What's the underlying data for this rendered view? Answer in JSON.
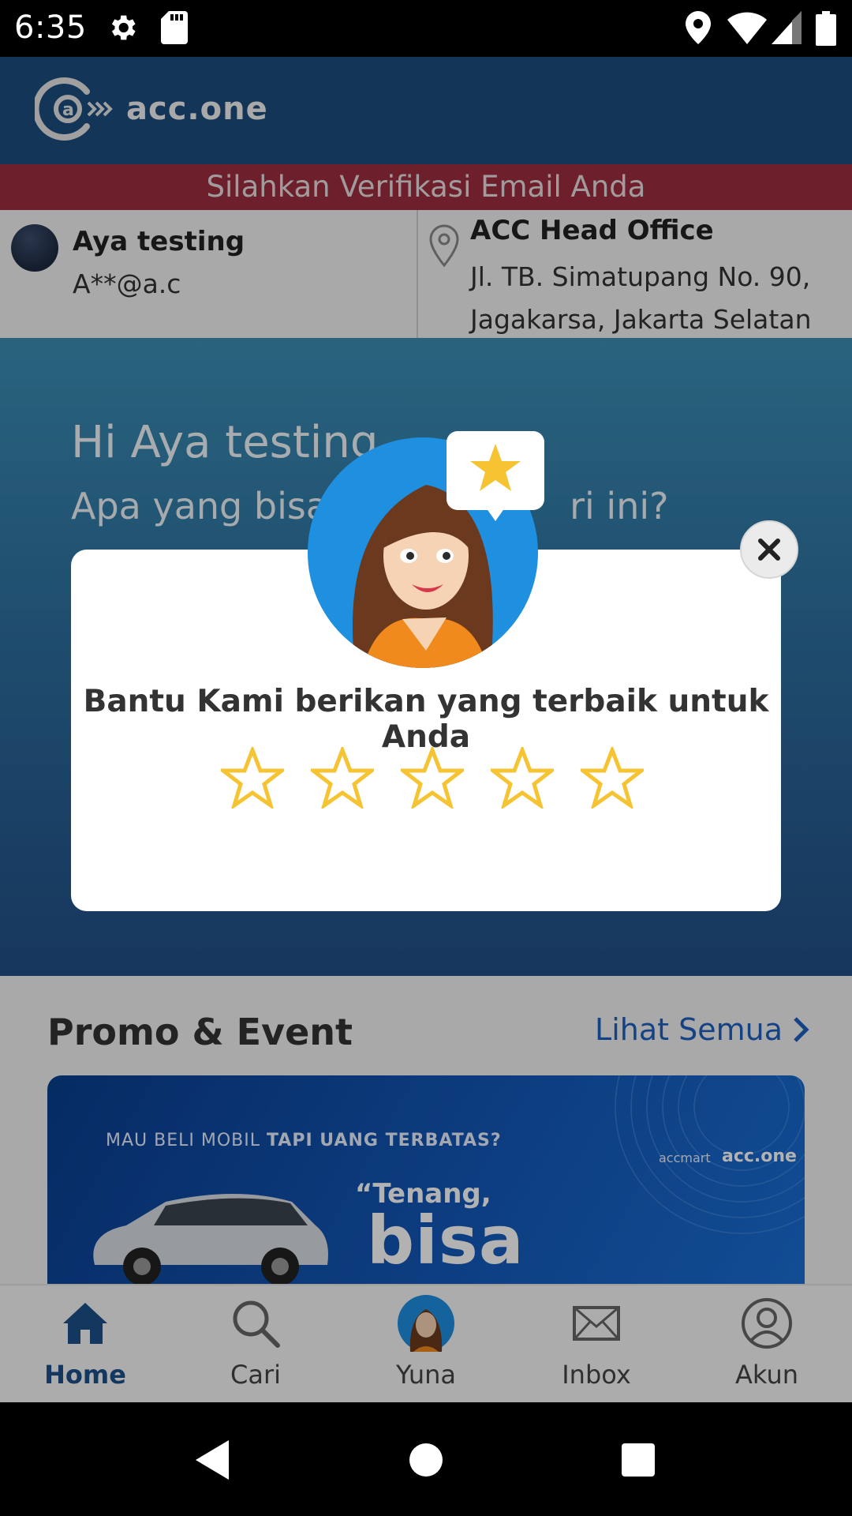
{
  "status_bar": {
    "time": "6:35"
  },
  "header": {
    "logo_text": "acc.one"
  },
  "verify_banner": {
    "text": "Silahkan Verifikasi Email Anda"
  },
  "user": {
    "name": "Aya testing",
    "email": "A**@a.c"
  },
  "office": {
    "name": "ACC Head Office",
    "address_line1": "Jl. TB. Simatupang No. 90,",
    "address_line2": "Jagakarsa, Jakarta Selatan"
  },
  "hero": {
    "greeting": "Hi Aya testing",
    "question": "Apa yang bisa A",
    "question_end": "ri ini?"
  },
  "dialog": {
    "message": "Bantu Kami berikan yang terbaik untuk Anda",
    "rating": 0,
    "max_rating": 5
  },
  "promo": {
    "title": "Promo & Event",
    "see_all": "Lihat Semua",
    "banner": {
      "line1_a": "MAU BELI MOBIL ",
      "line1_b": "TAPI UANG TERBATAS?",
      "line2": "“Tenang,",
      "line3": "bisa dicicil.”",
      "brand1": "accmart",
      "brand2": "acc.one"
    }
  },
  "bottom_nav": {
    "items": [
      {
        "label": "Home",
        "icon": "home-icon",
        "active": true
      },
      {
        "label": "Cari",
        "icon": "search-icon",
        "active": false
      },
      {
        "label": "Yuna",
        "icon": "yuna-avatar-icon",
        "active": false
      },
      {
        "label": "Inbox",
        "icon": "mail-icon",
        "active": false
      },
      {
        "label": "Akun",
        "icon": "account-icon",
        "active": false
      }
    ]
  },
  "colors": {
    "brand_blue": "#1c4d7f",
    "banner_red": "#9c2f3e",
    "star_yellow": "#f6c333",
    "link_blue": "#1f5fbf"
  }
}
